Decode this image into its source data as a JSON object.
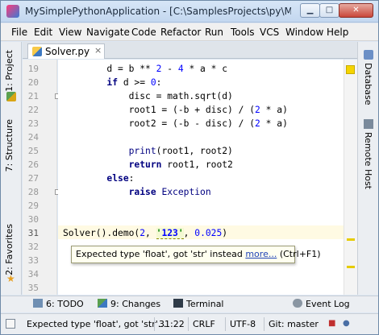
{
  "window": {
    "title": "MySimplePythonApplication - [C:\\SamplesProjects\\py\\MySi...",
    "minimize_icon": "minimize-icon",
    "maximize_icon": "maximize-icon",
    "close_icon": "close-icon"
  },
  "menubar": {
    "items": [
      "File",
      "Edit",
      "View",
      "Navigate",
      "Code",
      "Refactor",
      "Run",
      "Tools",
      "VCS",
      "Window",
      "Help"
    ]
  },
  "left_tools": {
    "project": "1: Project",
    "structure": "7: Structure",
    "favorites": "2: Favorites"
  },
  "right_tools": {
    "database": "Database",
    "remote_host": "Remote Host"
  },
  "editor_tab": {
    "label": "Solver.py",
    "close_glyph": "×"
  },
  "editor": {
    "line_numbers": [
      "19",
      "20",
      "21",
      "22",
      "23",
      "24",
      "25",
      "26",
      "27",
      "28",
      "29",
      "30",
      "31",
      "32",
      "33",
      "34",
      "35"
    ],
    "current_line": "31",
    "lines": [
      "        d = b ** 2 - 4 * a * c",
      "        if d >= 0:",
      "            disc = math.sqrt(d)",
      "            root1 = (-b + disc) / (2 * a)",
      "            root2 = (-b - disc) / (2 * a)",
      "",
      "            print(root1, root2)",
      "            return root1, root2",
      "        else:",
      "            raise Exception",
      "",
      "",
      "Solver().demo(2, '123', 0.025)",
      "",
      "",
      "",
      ""
    ]
  },
  "tooltip": {
    "message": "Expected type 'float', got 'str' instead ",
    "link": "more...",
    "shortcut": " (Ctrl+F1)"
  },
  "bottom_tools": {
    "todo": "6: TODO",
    "changes": "9: Changes",
    "terminal": "Terminal",
    "event_log": "Event Log"
  },
  "statusbar": {
    "message": "Expected type 'float', got 'str'...",
    "position": "31:22",
    "line_separator": "CRLF",
    "encoding": "UTF-8",
    "vcs": "Git: master"
  },
  "colors": {
    "caret_row": "#fffae3",
    "keyword": "#000080",
    "number": "#0000ff",
    "string": "#008000",
    "marker": "#e6cc00"
  }
}
